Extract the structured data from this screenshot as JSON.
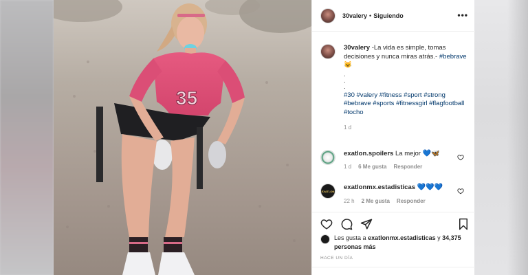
{
  "post": {
    "username": "30valery",
    "separator": "•",
    "follow_status": "Siguiendo",
    "more_label": "•••",
    "caption": {
      "text": "-La vida es simple, tomas decisiones y nunca miras atrás.-",
      "tag1": "#bebrave",
      "emoji": "😺",
      "dots": [
        ".",
        ".",
        "."
      ],
      "hashtags": [
        "#30",
        "#valery",
        "#fitness",
        "#sport",
        "#strong",
        "#bebrave",
        "#sports",
        "#fitnessgirl",
        "#flagfootball",
        "#tocho"
      ],
      "time": "1 d"
    },
    "comments": [
      {
        "username": "exatlon.spoilers",
        "text": "La mejor",
        "emojis": [
          "💙",
          "🦋"
        ],
        "time": "1 d",
        "likes": "6 Me gusta",
        "reply": "Responder"
      },
      {
        "username": "exatlonmx.estadisticas",
        "text": "",
        "emojis": [
          "💙",
          "💙",
          "💙"
        ],
        "time": "22 h",
        "likes": "2 Me gusta",
        "reply": "Responder",
        "avatar_text": "EXATLON"
      }
    ],
    "likes_summary": {
      "prefix": "Les gusta a",
      "user": "exatlonmx.estadisticas",
      "mid": "y",
      "count": "34,375 personas más"
    },
    "posted_ago": "HACE UN DÍA"
  },
  "colors": {
    "link": "#00376b",
    "secondary": "#8e8e8e",
    "jersey": "#e04a72"
  },
  "icons": [
    "heart-icon",
    "comment-icon",
    "share-icon",
    "bookmark-icon",
    "more-icon"
  ]
}
